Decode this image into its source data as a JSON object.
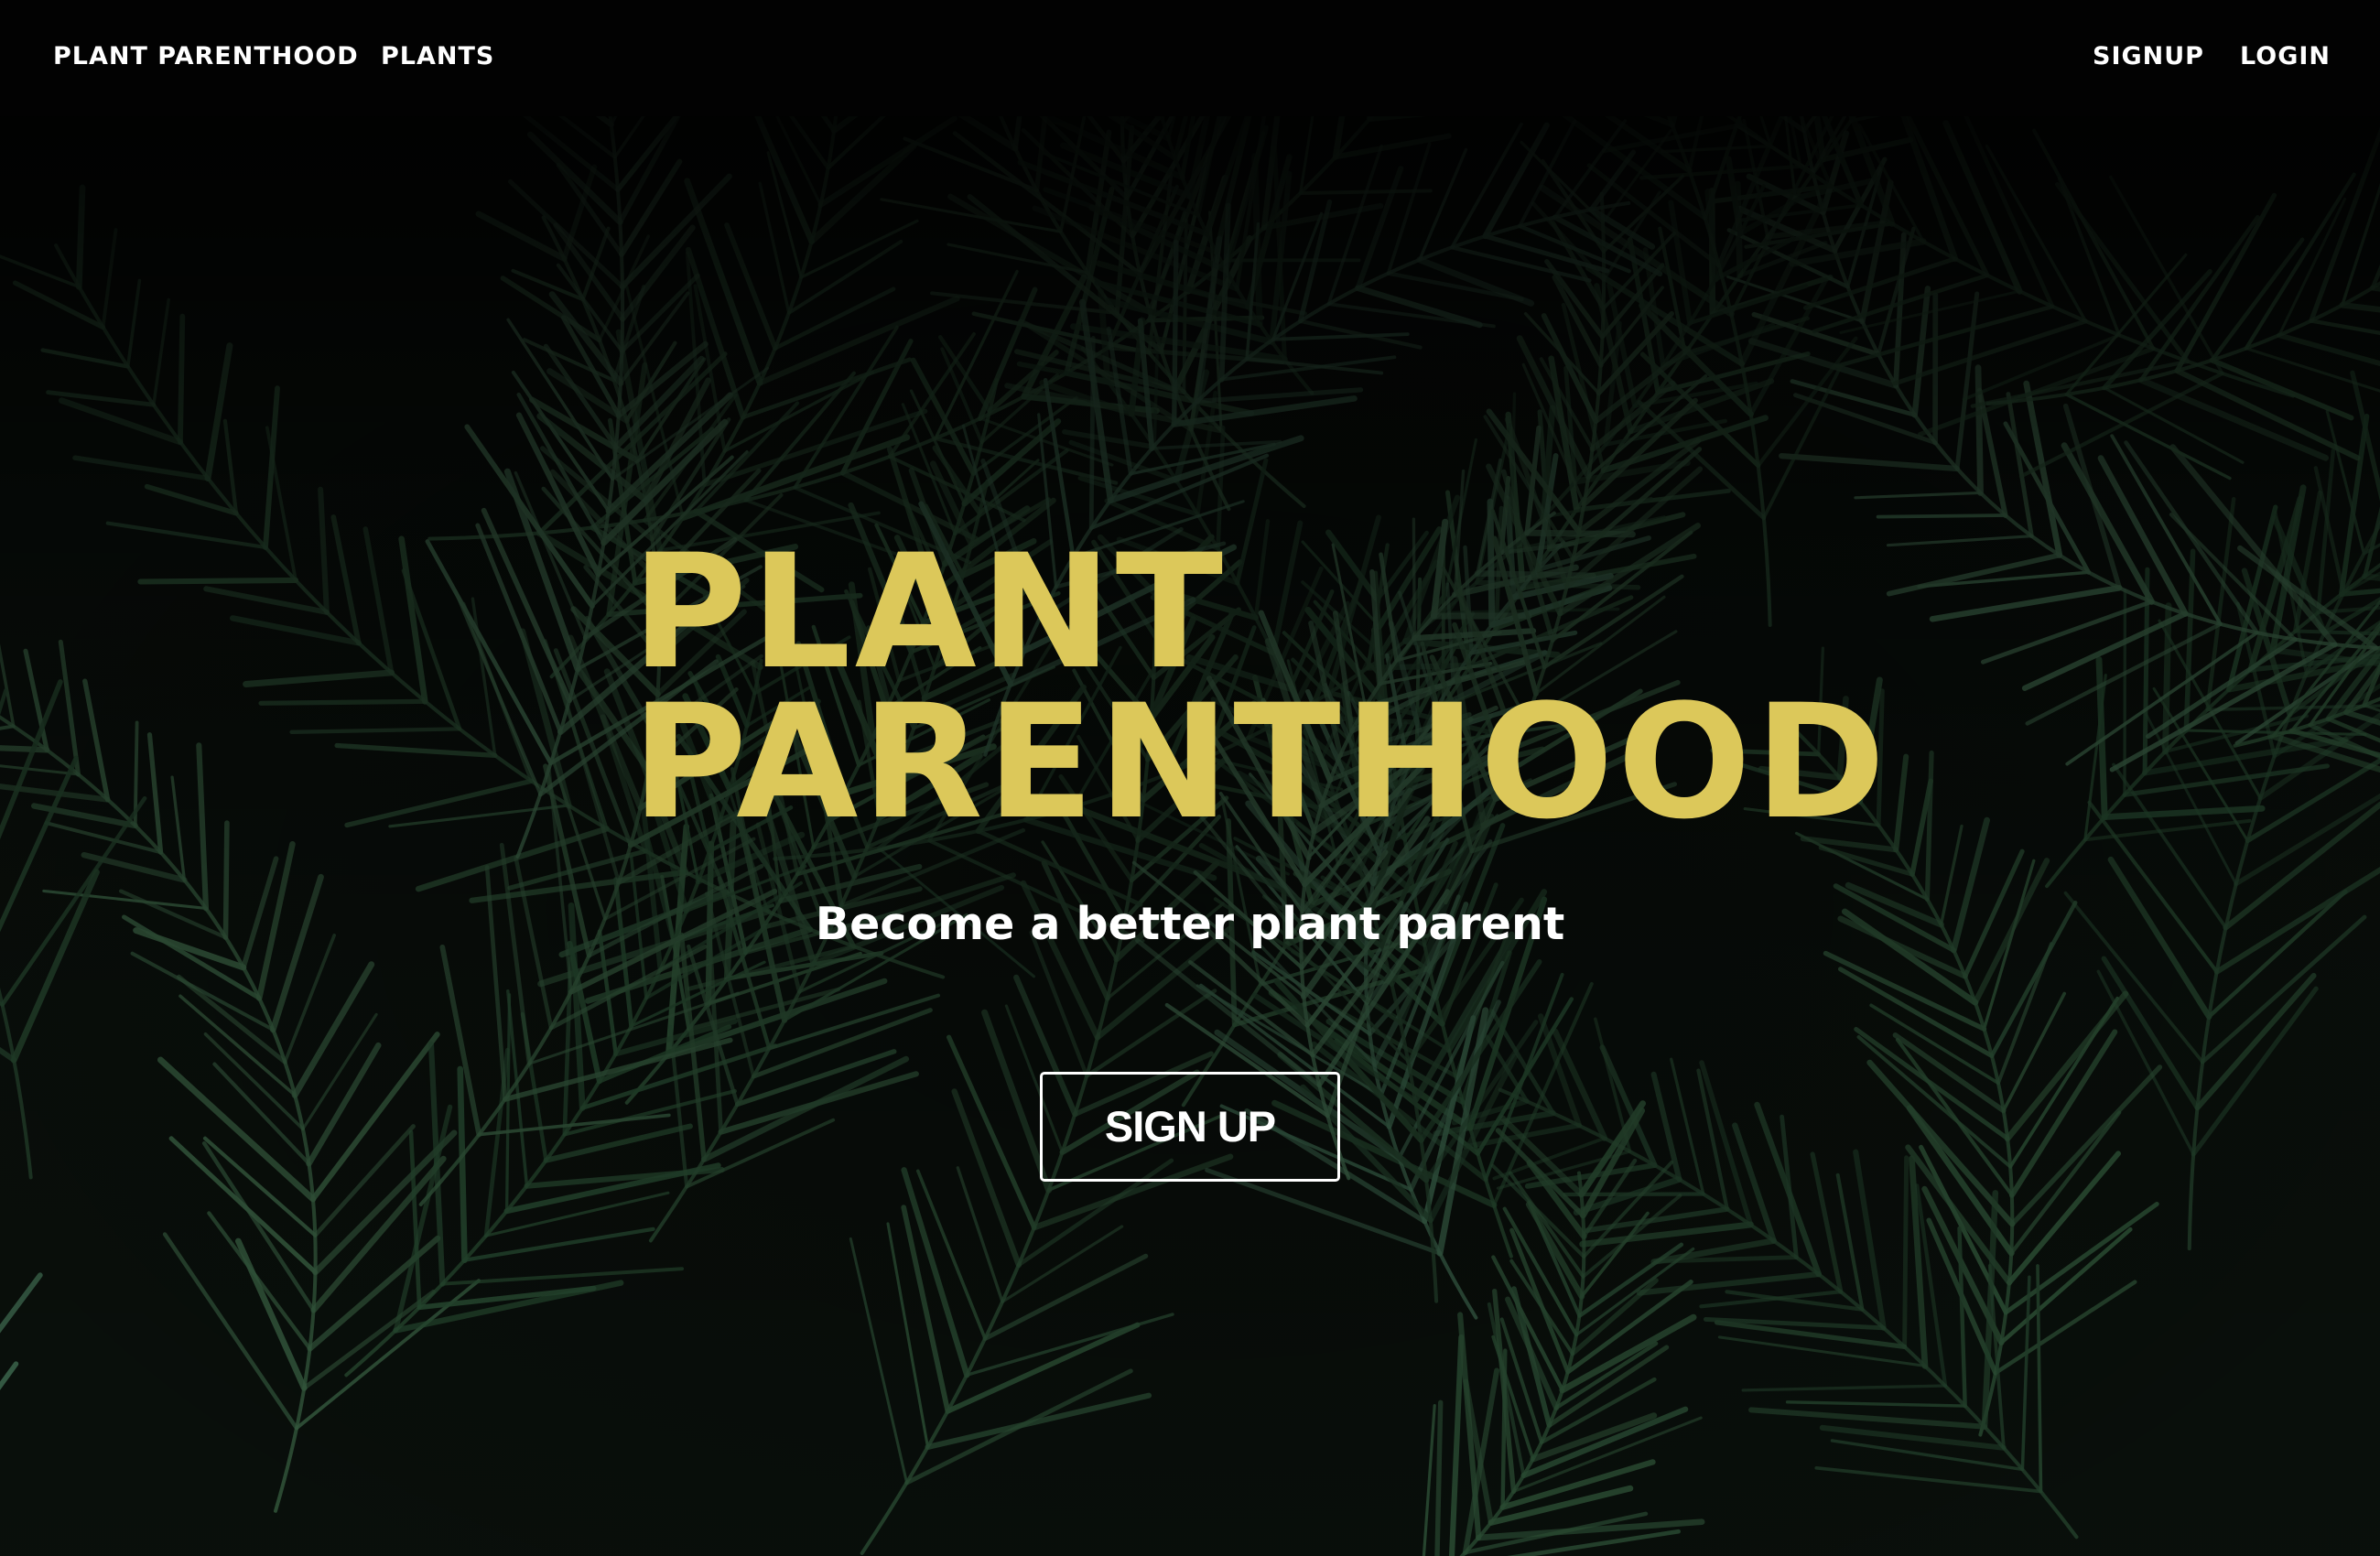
{
  "navbar": {
    "brand_label": "PLANT PARENTHOOD",
    "plants_label": "PLANTS",
    "signup_label": "SIGNUP",
    "login_label": "LOGIN"
  },
  "hero": {
    "title_line1": "PLANT",
    "title_line2": "PARENTHOOD",
    "subtitle": "Become a better plant parent",
    "cta_label": "SIGN UP",
    "background": "palm-fronds-photo"
  },
  "colors": {
    "navbar_bg": "#020202",
    "title": "#dcc85a",
    "text": "#ffffff",
    "foliage": "#3f6b4a"
  }
}
